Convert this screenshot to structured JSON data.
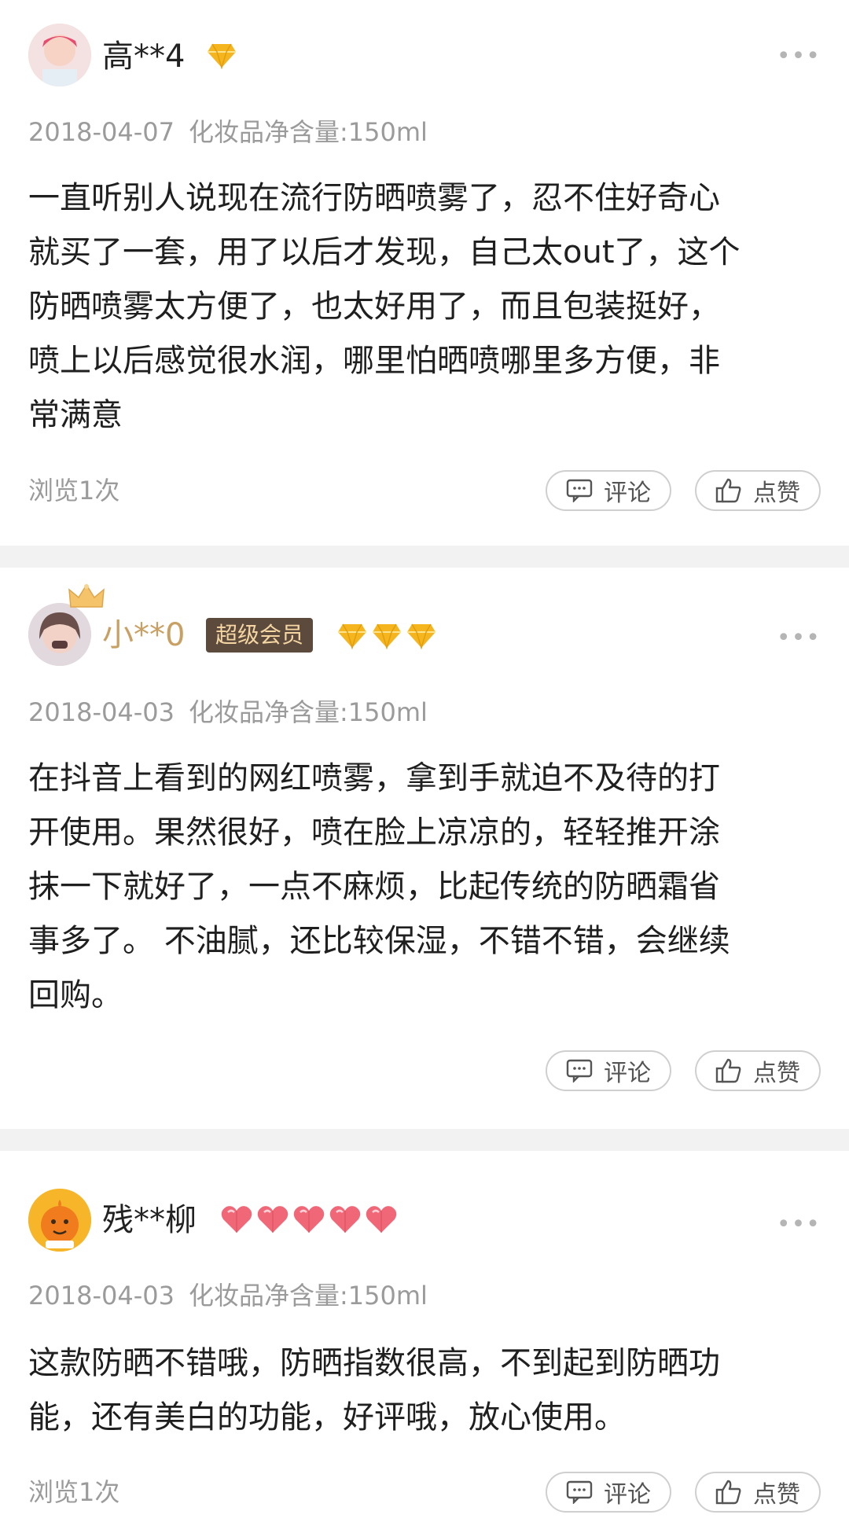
{
  "reviews": [
    {
      "username": "高**4",
      "level_icons": [
        "diamond-icon"
      ],
      "date": "2018-04-07",
      "spec": "化妆品净含量:150ml",
      "body": "一直听别人说现在流行防晒喷雾了，忍不住好奇心\n就买了一套，用了以后才发现，自己太out了，这个\n防晒喷雾太方便了，也太好用了，而且包装挺好，\n喷上以后感觉很水润，哪里怕晒喷哪里多方便，非\n常满意",
      "views": "浏览1次",
      "comment_label": "评论",
      "like_label": "点赞"
    },
    {
      "username": "小**0",
      "badge": "超级会员",
      "level_icons": [
        "diamond-icon",
        "diamond-icon",
        "diamond-icon"
      ],
      "date": "2018-04-03",
      "spec": "化妆品净含量:150ml",
      "body": "在抖音上看到的网红喷雾，拿到手就迫不及待的打\n开使用。果然很好，喷在脸上凉凉的，轻轻推开涂\n抹一下就好了，一点不麻烦，比起传统的防晒霜省\n事多了。 不油腻，还比较保湿，不错不错，会继续\n回购。",
      "comment_label": "评论",
      "like_label": "点赞"
    },
    {
      "username": "残**柳",
      "level_icons": [
        "heart-icon",
        "heart-icon",
        "heart-icon",
        "heart-icon",
        "heart-icon"
      ],
      "date": "2018-04-03",
      "spec": "化妆品净含量:150ml",
      "body": "这款防晒不错哦，防晒指数很高，不到起到防晒功\n能，还有美白的功能，好评哦，放心使用。",
      "views": "浏览1次",
      "comment_label": "评论",
      "like_label": "点赞"
    }
  ],
  "more_icon": "ellipsis-icon",
  "colors": {
    "vip_name": "#c9a063",
    "diamond": "#f5b51e",
    "heart": "#f06878",
    "badge_bg": "#5c4b3c"
  }
}
